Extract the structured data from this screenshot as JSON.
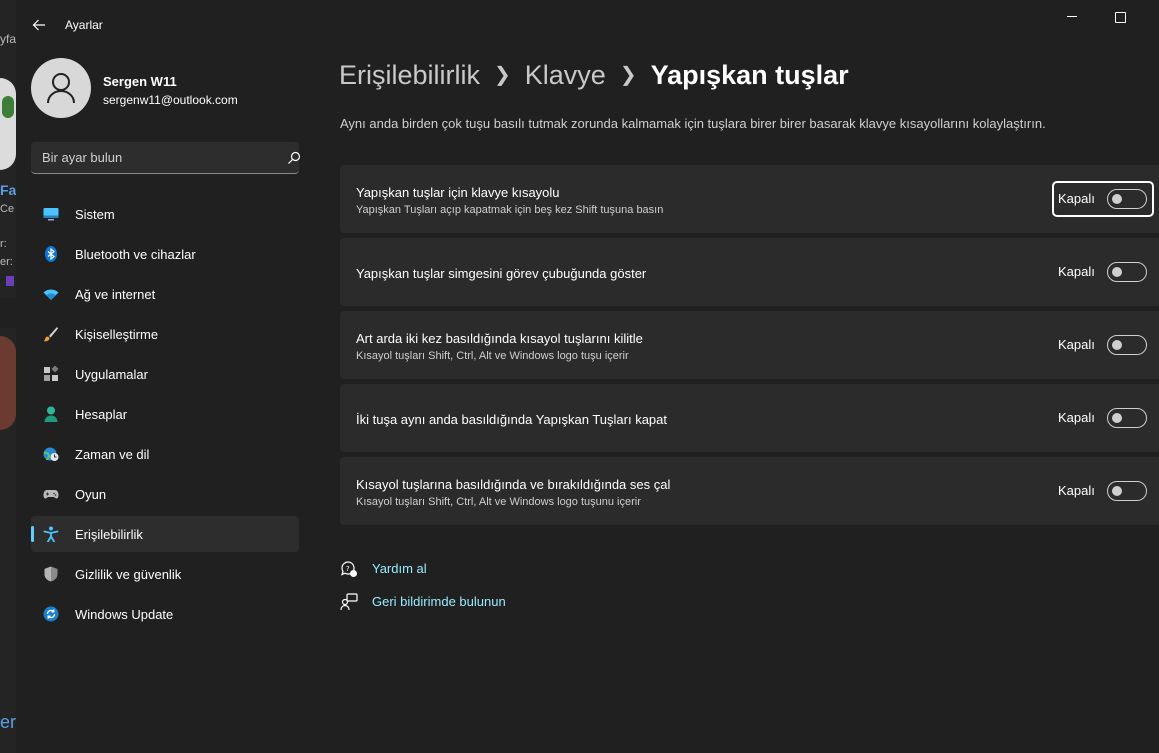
{
  "window": {
    "title": "Ayarlar"
  },
  "profile": {
    "name": "Sergen W11",
    "email": "sergenw11@outlook.com"
  },
  "search": {
    "placeholder": "Bir ayar bulun"
  },
  "sidebar": {
    "items": [
      {
        "label": "Sistem",
        "icon": "monitor-icon"
      },
      {
        "label": "Bluetooth ve cihazlar",
        "icon": "bluetooth-icon"
      },
      {
        "label": "Ağ ve internet",
        "icon": "wifi-icon"
      },
      {
        "label": "Kişiselleştirme",
        "icon": "brush-icon"
      },
      {
        "label": "Uygulamalar",
        "icon": "apps-icon"
      },
      {
        "label": "Hesaplar",
        "icon": "person-icon"
      },
      {
        "label": "Zaman ve dil",
        "icon": "globe-clock-icon"
      },
      {
        "label": "Oyun",
        "icon": "gamepad-icon"
      },
      {
        "label": "Erişilebilirlik",
        "icon": "accessibility-icon",
        "active": true
      },
      {
        "label": "Gizlilik ve güvenlik",
        "icon": "shield-icon"
      },
      {
        "label": "Windows Update",
        "icon": "update-icon"
      }
    ]
  },
  "breadcrumb": {
    "level1": "Erişilebilirlik",
    "level2": "Klavye",
    "current": "Yapışkan tuşlar"
  },
  "description": "Aynı anda birden çok tuşu basılı tutmak zorunda kalmamak için tuşlara birer birer basarak klavye kısayollarını kolaylaştırın.",
  "settings": [
    {
      "title": "Yapışkan tuşlar için klavye kısayolu",
      "subtitle": "Yapışkan Tuşları açıp kapatmak için beş kez Shift tuşuna basın",
      "state": "Kapalı"
    },
    {
      "title": "Yapışkan tuşlar simgesini görev çubuğunda göster",
      "subtitle": "",
      "state": "Kapalı"
    },
    {
      "title": "Art arda iki kez basıldığında kısayol tuşlarını kilitle",
      "subtitle": "Kısayol tuşları Shift, Ctrl, Alt ve Windows logo tuşu içerir",
      "state": "Kapalı"
    },
    {
      "title": "İki tuşa aynı anda basıldığında Yapışkan Tuşları kapat",
      "subtitle": "",
      "state": "Kapalı"
    },
    {
      "title": "Kısayol tuşlarına basıldığında ve bırakıldığında ses çal",
      "subtitle": "Kısayol tuşları Shift, Ctrl, Alt ve Windows logo tuşunu içerir",
      "state": "Kapalı"
    }
  ],
  "links": {
    "help": "Yardım al",
    "feedback": "Geri bildirimde bulunun"
  },
  "colors": {
    "accent": "#60cdff",
    "link": "#99ebff",
    "background": "#202020",
    "card": "#2b2b2b"
  },
  "background_window": {
    "fragments": [
      "yfa",
      "Fa",
      "Ce",
      "r:",
      "er:",
      "er"
    ]
  }
}
